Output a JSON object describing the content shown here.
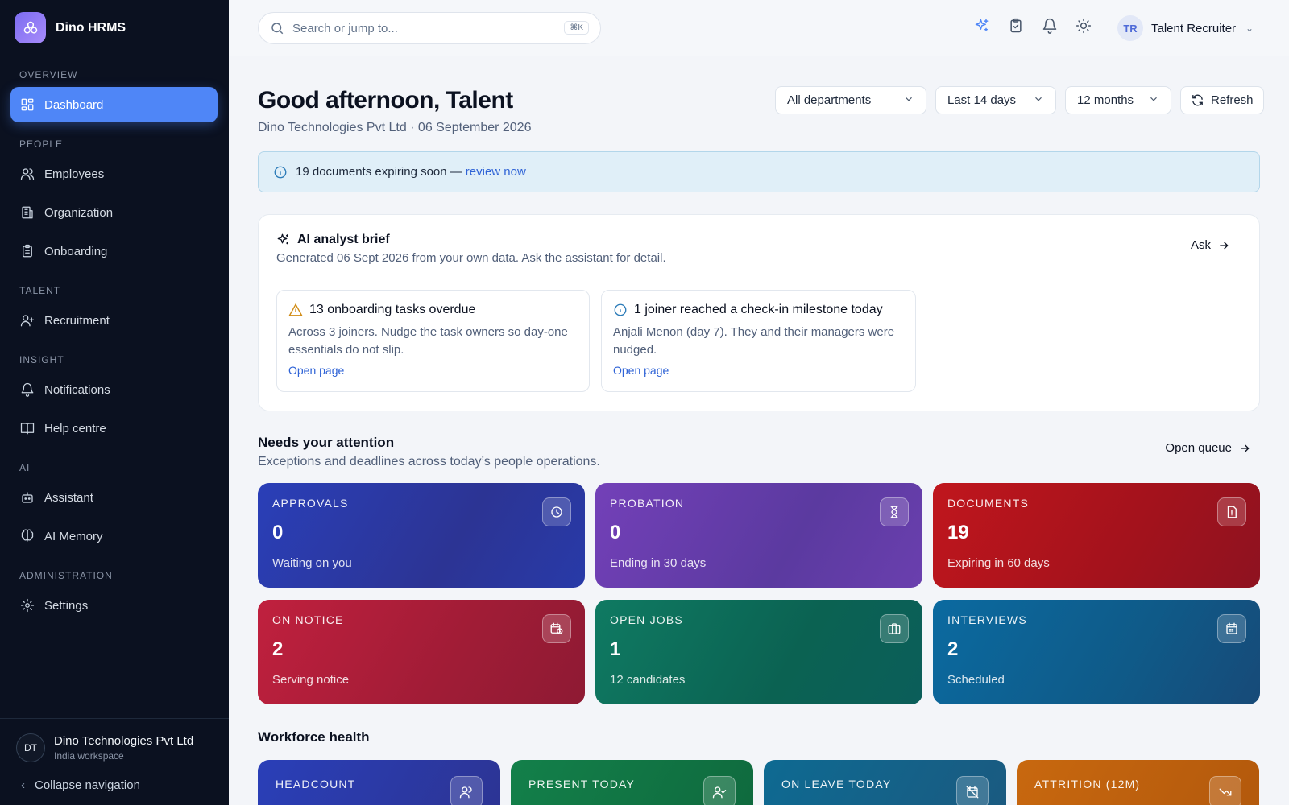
{
  "brand": {
    "name": "Dino HRMS"
  },
  "nav": {
    "sections": {
      "overview": "OVERVIEW",
      "people": "PEOPLE",
      "talent": "TALENT",
      "insight": "INSIGHT",
      "ai": "AI",
      "administration": "ADMINISTRATION"
    },
    "items": {
      "dashboard": "Dashboard",
      "employees": "Employees",
      "organization": "Organization",
      "onboarding": "Onboarding",
      "recruitment": "Recruitment",
      "notifications": "Notifications",
      "help": "Help centre",
      "assistant": "Assistant",
      "memory": "AI Memory",
      "settings": "Settings"
    },
    "active": "Dashboard"
  },
  "footer": {
    "org_initials": "DT",
    "org_name": "Dino Technologies Pvt Ltd",
    "org_sub": "India workspace",
    "collapse_label": "Collapse navigation"
  },
  "topbar": {
    "search_placeholder": "Search or jump to...",
    "shortcut": "⌘K",
    "user_initials": "TR",
    "user_name": "Talent Recruiter"
  },
  "header": {
    "greeting": "Good afternoon, Talent",
    "subline": "Dino Technologies Pvt Ltd · 06 September 2026",
    "filters": {
      "department": "All departments",
      "range": "Last 14 days",
      "period": "12 months"
    },
    "refresh_label": "Refresh"
  },
  "banner": {
    "text": "19 documents expiring soon —",
    "link": "review now"
  },
  "ai_brief": {
    "title": "AI analyst brief",
    "subtitle": "Generated 06 Sept 2026 from your own data. Ask the assistant for detail.",
    "ask_label": "Ask",
    "cards": [
      {
        "icon": "warning-icon",
        "title": "13 onboarding tasks overdue",
        "body": "Across 3 joiners. Nudge the task owners so day-one essentials do not slip.",
        "link": "Open page"
      },
      {
        "icon": "info-icon",
        "title": "1 joiner reached a check-in milestone today",
        "body": "Anjali Menon (day 7). They and their managers were nudged.",
        "link": "Open page"
      }
    ]
  },
  "attention": {
    "title": "Needs your attention",
    "subtitle": "Exceptions and deadlines across today’s people operations.",
    "open_queue": "Open queue",
    "tiles": [
      {
        "label": "APPROVALS",
        "value": "0",
        "sub": "Waiting on you",
        "icon": "clock-icon",
        "color": "#2b3db8"
      },
      {
        "label": "PROBATION",
        "value": "0",
        "sub": "Ending in 30 days",
        "icon": "hourglass-icon",
        "color": "#6a3fb2"
      },
      {
        "label": "DOCUMENTS",
        "value": "19",
        "sub": "Expiring in 60 days",
        "icon": "document-alert-icon",
        "color": "#b0141e"
      },
      {
        "label": "ON NOTICE",
        "value": "2",
        "sub": "Serving notice",
        "icon": "calendar-clock-icon",
        "color": "#b21e3a"
      },
      {
        "label": "OPEN JOBS",
        "value": "1",
        "sub": "12 candidates",
        "icon": "briefcase-icon",
        "color": "#0b6e5e"
      },
      {
        "label": "INTERVIEWS",
        "value": "2",
        "sub": "Scheduled",
        "icon": "calendar-icon",
        "color": "#0e5e8e"
      }
    ]
  },
  "workforce": {
    "title": "Workforce health",
    "tiles": [
      {
        "label": "HEADCOUNT",
        "icon": "users-icon",
        "color": "#2b3db8"
      },
      {
        "label": "PRESENT TODAY",
        "icon": "user-check-icon",
        "color": "#137a44"
      },
      {
        "label": "ON LEAVE TODAY",
        "icon": "calendar-off-icon",
        "color": "#0e6a92"
      },
      {
        "label": "ATTRITION (12M)",
        "icon": "trending-down-icon",
        "color": "#c2620f"
      }
    ]
  }
}
